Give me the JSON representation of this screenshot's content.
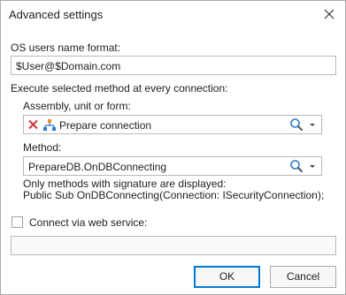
{
  "window": {
    "title": "Advanced settings",
    "close_icon": "close-icon"
  },
  "os_user": {
    "label": "OS users name format:",
    "value": "$User@$Domain.com"
  },
  "execute": {
    "label": "Execute selected method at every connection:",
    "assembly": {
      "label": "Assembly, unit or form:",
      "value": "Prepare connection",
      "clear_icon": "clear-red-x-icon",
      "type_icon": "hierarchy-icon",
      "search_icon": "magnifier-icon",
      "dropdown_icon": "dropdown-arrow-icon"
    },
    "method": {
      "label": "Method:",
      "value": "PrepareDB.OnDBConnecting",
      "search_icon": "magnifier-icon",
      "dropdown_icon": "dropdown-arrow-icon"
    },
    "note_line1": "Only methods with signature are displayed:",
    "note_line2": "Public Sub OnDBConnecting(Connection: ISecurityConnection);"
  },
  "web_service": {
    "label": "Connect via web service:",
    "checked": false,
    "value": ""
  },
  "buttons": {
    "ok": "OK",
    "cancel": "Cancel"
  },
  "colors": {
    "accent": "#0078d7",
    "clear_red": "#d13438",
    "hierarchy_orange": "#e8901c",
    "hierarchy_blue": "#2b79c7"
  }
}
